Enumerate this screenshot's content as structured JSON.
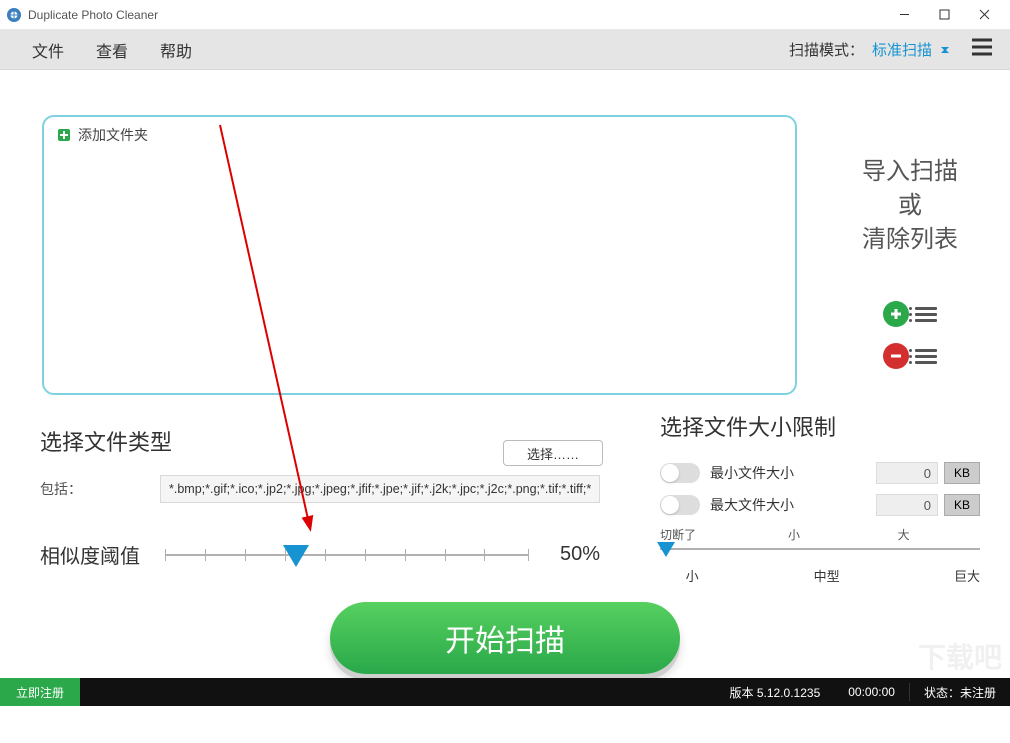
{
  "window": {
    "title": "Duplicate Photo Cleaner"
  },
  "menu": {
    "file": "文件",
    "view": "查看",
    "help": "帮助"
  },
  "scanmode": {
    "label": "扫描模式：",
    "value": "标准扫描"
  },
  "dropzone": {
    "add_folder": "添加文件夹"
  },
  "rightcol": {
    "line1": "导入扫描",
    "line2": "或",
    "line3": "清除列表"
  },
  "filetype": {
    "title": "选择文件类型",
    "select_btn": "选择……",
    "include_label": "包括：",
    "include_value": "*.bmp;*.gif;*.ico;*.jp2;*.jpg;*.jpeg;*.jfif;*.jpe;*.jif;*.j2k;*.jpc;*.j2c;*.png;*.tif;*.tiff;*.tga"
  },
  "similarity": {
    "label": "相似度阈值",
    "value": "50%",
    "position_pct": 36
  },
  "sizelimit": {
    "title": "选择文件大小限制",
    "min_label": "最小文件大小",
    "min_value": "0",
    "min_unit": "KB",
    "max_label": "最大文件大小",
    "max_value": "0",
    "max_unit": "KB"
  },
  "cutoff": {
    "top_left": "切断了",
    "top_mid": "小",
    "top_right": "大",
    "bot_left": "小",
    "bot_mid": "中型",
    "bot_right": "巨大"
  },
  "start": {
    "label": "开始扫描"
  },
  "status": {
    "register": "立即注册",
    "version": "版本 5.12.0.1235",
    "time": "00:00:00",
    "state_label": "状态：",
    "state_value": "未注册"
  },
  "watermark": "下载吧"
}
